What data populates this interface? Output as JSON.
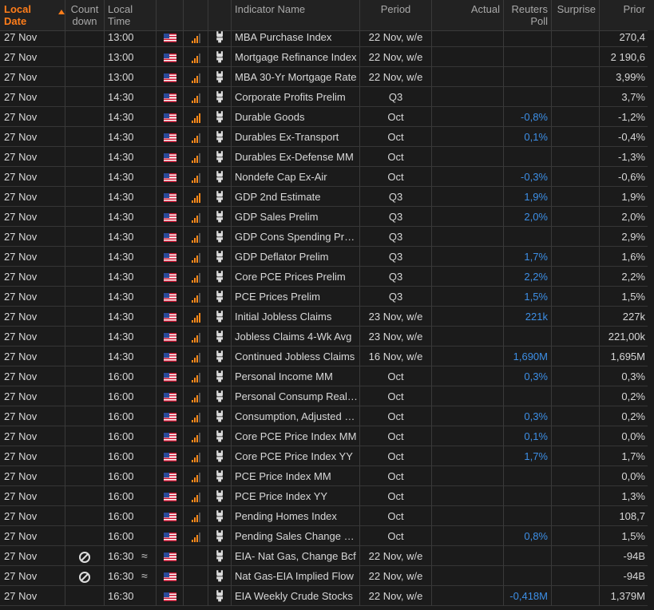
{
  "header": {
    "local_date": "Local Date",
    "countdown": "Count down",
    "local_time": "Local Time",
    "indicator_name": "Indicator Name",
    "period": "Period",
    "actual": "Actual",
    "reuters_poll": "Reuters Poll",
    "surprise": "Surprise",
    "prior": "Prior"
  },
  "colors": {
    "accent": "#ff7d1a",
    "poll_blue": "#3d8fe6",
    "flag_red": "#c8102e",
    "flag_blue": "#2a4a9a"
  },
  "icons": {
    "flag": "us-flag-icon",
    "importance": "importance-bars-icon",
    "history": "history-chart-icon",
    "countdown": "no-entry-icon",
    "approx": "approx-icon"
  },
  "rows": [
    {
      "date": "27 Nov",
      "time": "13:00",
      "importance": 3,
      "name": "MBA Purchase Index",
      "period": "22 Nov, w/e",
      "actual": "",
      "poll": "",
      "surprise": "",
      "prior": "270,4",
      "countdown": false
    },
    {
      "date": "27 Nov",
      "time": "13:00",
      "importance": 3,
      "name": "Mortgage Refinance Index",
      "period": "22 Nov, w/e",
      "actual": "",
      "poll": "",
      "surprise": "",
      "prior": "2 190,6",
      "countdown": false
    },
    {
      "date": "27 Nov",
      "time": "13:00",
      "importance": 3,
      "name": "MBA 30-Yr Mortgage Rate",
      "period": "22 Nov, w/e",
      "actual": "",
      "poll": "",
      "surprise": "",
      "prior": "3,99%",
      "countdown": false
    },
    {
      "date": "27 Nov",
      "time": "14:30",
      "importance": 3,
      "name": "Corporate Profits Prelim",
      "period": "Q3",
      "actual": "",
      "poll": "",
      "surprise": "",
      "prior": "3,7%",
      "countdown": false
    },
    {
      "date": "27 Nov",
      "time": "14:30",
      "importance": 4,
      "name": "Durable Goods",
      "period": "Oct",
      "actual": "",
      "poll": "-0,8%",
      "surprise": "",
      "prior": "-1,2%",
      "countdown": false
    },
    {
      "date": "27 Nov",
      "time": "14:30",
      "importance": 3,
      "name": "Durables Ex-Transport",
      "period": "Oct",
      "actual": "",
      "poll": "0,1%",
      "surprise": "",
      "prior": "-0,4%",
      "countdown": false
    },
    {
      "date": "27 Nov",
      "time": "14:30",
      "importance": 3,
      "name": "Durables Ex-Defense MM",
      "period": "Oct",
      "actual": "",
      "poll": "",
      "surprise": "",
      "prior": "-1,3%",
      "countdown": false
    },
    {
      "date": "27 Nov",
      "time": "14:30",
      "importance": 3,
      "name": "Nondefe Cap Ex-Air",
      "period": "Oct",
      "actual": "",
      "poll": "-0,3%",
      "surprise": "",
      "prior": "-0,6%",
      "countdown": false
    },
    {
      "date": "27 Nov",
      "time": "14:30",
      "importance": 4,
      "name": "GDP 2nd Estimate",
      "period": "Q3",
      "actual": "",
      "poll": "1,9%",
      "surprise": "",
      "prior": "1,9%",
      "countdown": false
    },
    {
      "date": "27 Nov",
      "time": "14:30",
      "importance": 3,
      "name": "GDP Sales Prelim",
      "period": "Q3",
      "actual": "",
      "poll": "2,0%",
      "surprise": "",
      "prior": "2,0%",
      "countdown": false
    },
    {
      "date": "27 Nov",
      "time": "14:30",
      "importance": 3,
      "name": "GDP Cons Spending Prelim",
      "period": "Q3",
      "actual": "",
      "poll": "",
      "surprise": "",
      "prior": "2,9%",
      "countdown": false
    },
    {
      "date": "27 Nov",
      "time": "14:30",
      "importance": 3,
      "name": "GDP Deflator Prelim",
      "period": "Q3",
      "actual": "",
      "poll": "1,7%",
      "surprise": "",
      "prior": "1,6%",
      "countdown": false
    },
    {
      "date": "27 Nov",
      "time": "14:30",
      "importance": 3,
      "name": "Core PCE Prices Prelim",
      "period": "Q3",
      "actual": "",
      "poll": "2,2%",
      "surprise": "",
      "prior": "2,2%",
      "countdown": false
    },
    {
      "date": "27 Nov",
      "time": "14:30",
      "importance": 3,
      "name": "PCE Prices Prelim",
      "period": "Q3",
      "actual": "",
      "poll": "1,5%",
      "surprise": "",
      "prior": "1,5%",
      "countdown": false
    },
    {
      "date": "27 Nov",
      "time": "14:30",
      "importance": 4,
      "name": "Initial Jobless Claims",
      "period": "23 Nov, w/e",
      "actual": "",
      "poll": "221k",
      "surprise": "",
      "prior": "227k",
      "countdown": false
    },
    {
      "date": "27 Nov",
      "time": "14:30",
      "importance": 3,
      "name": "Jobless Claims 4-Wk Avg",
      "period": "23 Nov, w/e",
      "actual": "",
      "poll": "",
      "surprise": "",
      "prior": "221,00k",
      "countdown": false
    },
    {
      "date": "27 Nov",
      "time": "14:30",
      "importance": 3,
      "name": "Continued Jobless Claims",
      "period": "16 Nov, w/e",
      "actual": "",
      "poll": "1,690M",
      "surprise": "",
      "prior": "1,695M",
      "countdown": false
    },
    {
      "date": "27 Nov",
      "time": "16:00",
      "importance": 3,
      "name": "Personal Income MM",
      "period": "Oct",
      "actual": "",
      "poll": "0,3%",
      "surprise": "",
      "prior": "0,3%",
      "countdown": false
    },
    {
      "date": "27 Nov",
      "time": "16:00",
      "importance": 3,
      "name": "Personal Consump Real MM",
      "period": "Oct",
      "actual": "",
      "poll": "",
      "surprise": "",
      "prior": "0,2%",
      "countdown": false
    },
    {
      "date": "27 Nov",
      "time": "16:00",
      "importance": 3,
      "name": "Consumption, Adjusted MM",
      "period": "Oct",
      "actual": "",
      "poll": "0,3%",
      "surprise": "",
      "prior": "0,2%",
      "countdown": false
    },
    {
      "date": "27 Nov",
      "time": "16:00",
      "importance": 3,
      "name": "Core PCE Price Index MM",
      "period": "Oct",
      "actual": "",
      "poll": "0,1%",
      "surprise": "",
      "prior": "0,0%",
      "countdown": false
    },
    {
      "date": "27 Nov",
      "time": "16:00",
      "importance": 3,
      "name": "Core PCE Price Index YY",
      "period": "Oct",
      "actual": "",
      "poll": "1,7%",
      "surprise": "",
      "prior": "1,7%",
      "countdown": false
    },
    {
      "date": "27 Nov",
      "time": "16:00",
      "importance": 3,
      "name": "PCE Price Index MM",
      "period": "Oct",
      "actual": "",
      "poll": "",
      "surprise": "",
      "prior": "0,0%",
      "countdown": false
    },
    {
      "date": "27 Nov",
      "time": "16:00",
      "importance": 3,
      "name": "PCE Price Index YY",
      "period": "Oct",
      "actual": "",
      "poll": "",
      "surprise": "",
      "prior": "1,3%",
      "countdown": false
    },
    {
      "date": "27 Nov",
      "time": "16:00",
      "importance": 3,
      "name": "Pending Homes Index",
      "period": "Oct",
      "actual": "",
      "poll": "",
      "surprise": "",
      "prior": "108,7",
      "countdown": false
    },
    {
      "date": "27 Nov",
      "time": "16:00",
      "importance": 3,
      "name": "Pending Sales Change MM",
      "period": "Oct",
      "actual": "",
      "poll": "0,8%",
      "surprise": "",
      "prior": "1,5%",
      "countdown": false
    },
    {
      "date": "27 Nov",
      "time": "16:30",
      "importance": 0,
      "name": "EIA- Nat Gas, Change Bcf",
      "period": "22 Nov, w/e",
      "actual": "",
      "poll": "",
      "surprise": "",
      "prior": "-94B",
      "countdown": true
    },
    {
      "date": "27 Nov",
      "time": "16:30",
      "importance": 0,
      "name": "Nat Gas-EIA Implied Flow",
      "period": "22 Nov, w/e",
      "actual": "",
      "poll": "",
      "surprise": "",
      "prior": "-94B",
      "countdown": true
    },
    {
      "date": "27 Nov",
      "time": "16:30",
      "importance": 0,
      "name": "EIA Weekly Crude Stocks",
      "period": "22 Nov, w/e",
      "actual": "",
      "poll": "-0,418M",
      "surprise": "",
      "prior": "1,379M",
      "countdown": false
    }
  ]
}
